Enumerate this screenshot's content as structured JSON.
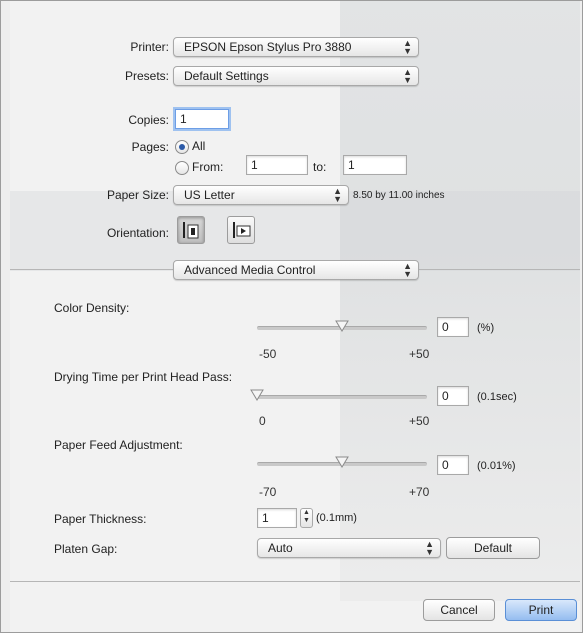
{
  "printer": {
    "label": "Printer:",
    "value": "EPSON Epson Stylus Pro 3880"
  },
  "presets": {
    "label": "Presets:",
    "value": "Default Settings"
  },
  "copies": {
    "label": "Copies:",
    "value": "1"
  },
  "pages": {
    "label": "Pages:",
    "all_label": "All",
    "from_label": "From:",
    "from_value": "1",
    "to_label": "to:",
    "to_value": "1",
    "selected": "All"
  },
  "paper_size": {
    "label": "Paper Size:",
    "value": "US Letter",
    "dimensions": "8.50 by 11.00 inches"
  },
  "orientation": {
    "label": "Orientation:",
    "options": [
      "portrait-icon",
      "landscape-icon"
    ],
    "selected": "portrait"
  },
  "panel_menu": {
    "value": "Advanced Media Control"
  },
  "color_density": {
    "label": "Color Density:",
    "min": "-50",
    "max": "+50",
    "value": "0",
    "unit": "(%)",
    "position_fraction": 0.5
  },
  "drying_time": {
    "label": "Drying Time per Print Head Pass:",
    "min": "0",
    "max": "+50",
    "value": "0",
    "unit": "(0.1sec)",
    "position_fraction": 0.0
  },
  "paper_feed": {
    "label": "Paper Feed Adjustment:",
    "min": "-70",
    "max": "+70",
    "value": "0",
    "unit": "(0.01%)",
    "position_fraction": 0.5
  },
  "paper_thickness": {
    "label": "Paper Thickness:",
    "value": "1",
    "unit": "(0.1mm)"
  },
  "platen_gap": {
    "label": "Platen Gap:",
    "value": "Auto",
    "default_button": "Default"
  },
  "footer": {
    "cancel": "Cancel",
    "print": "Print"
  },
  "colors": {
    "accent": "#2b5aa8",
    "default_button": "#95bdf0"
  }
}
